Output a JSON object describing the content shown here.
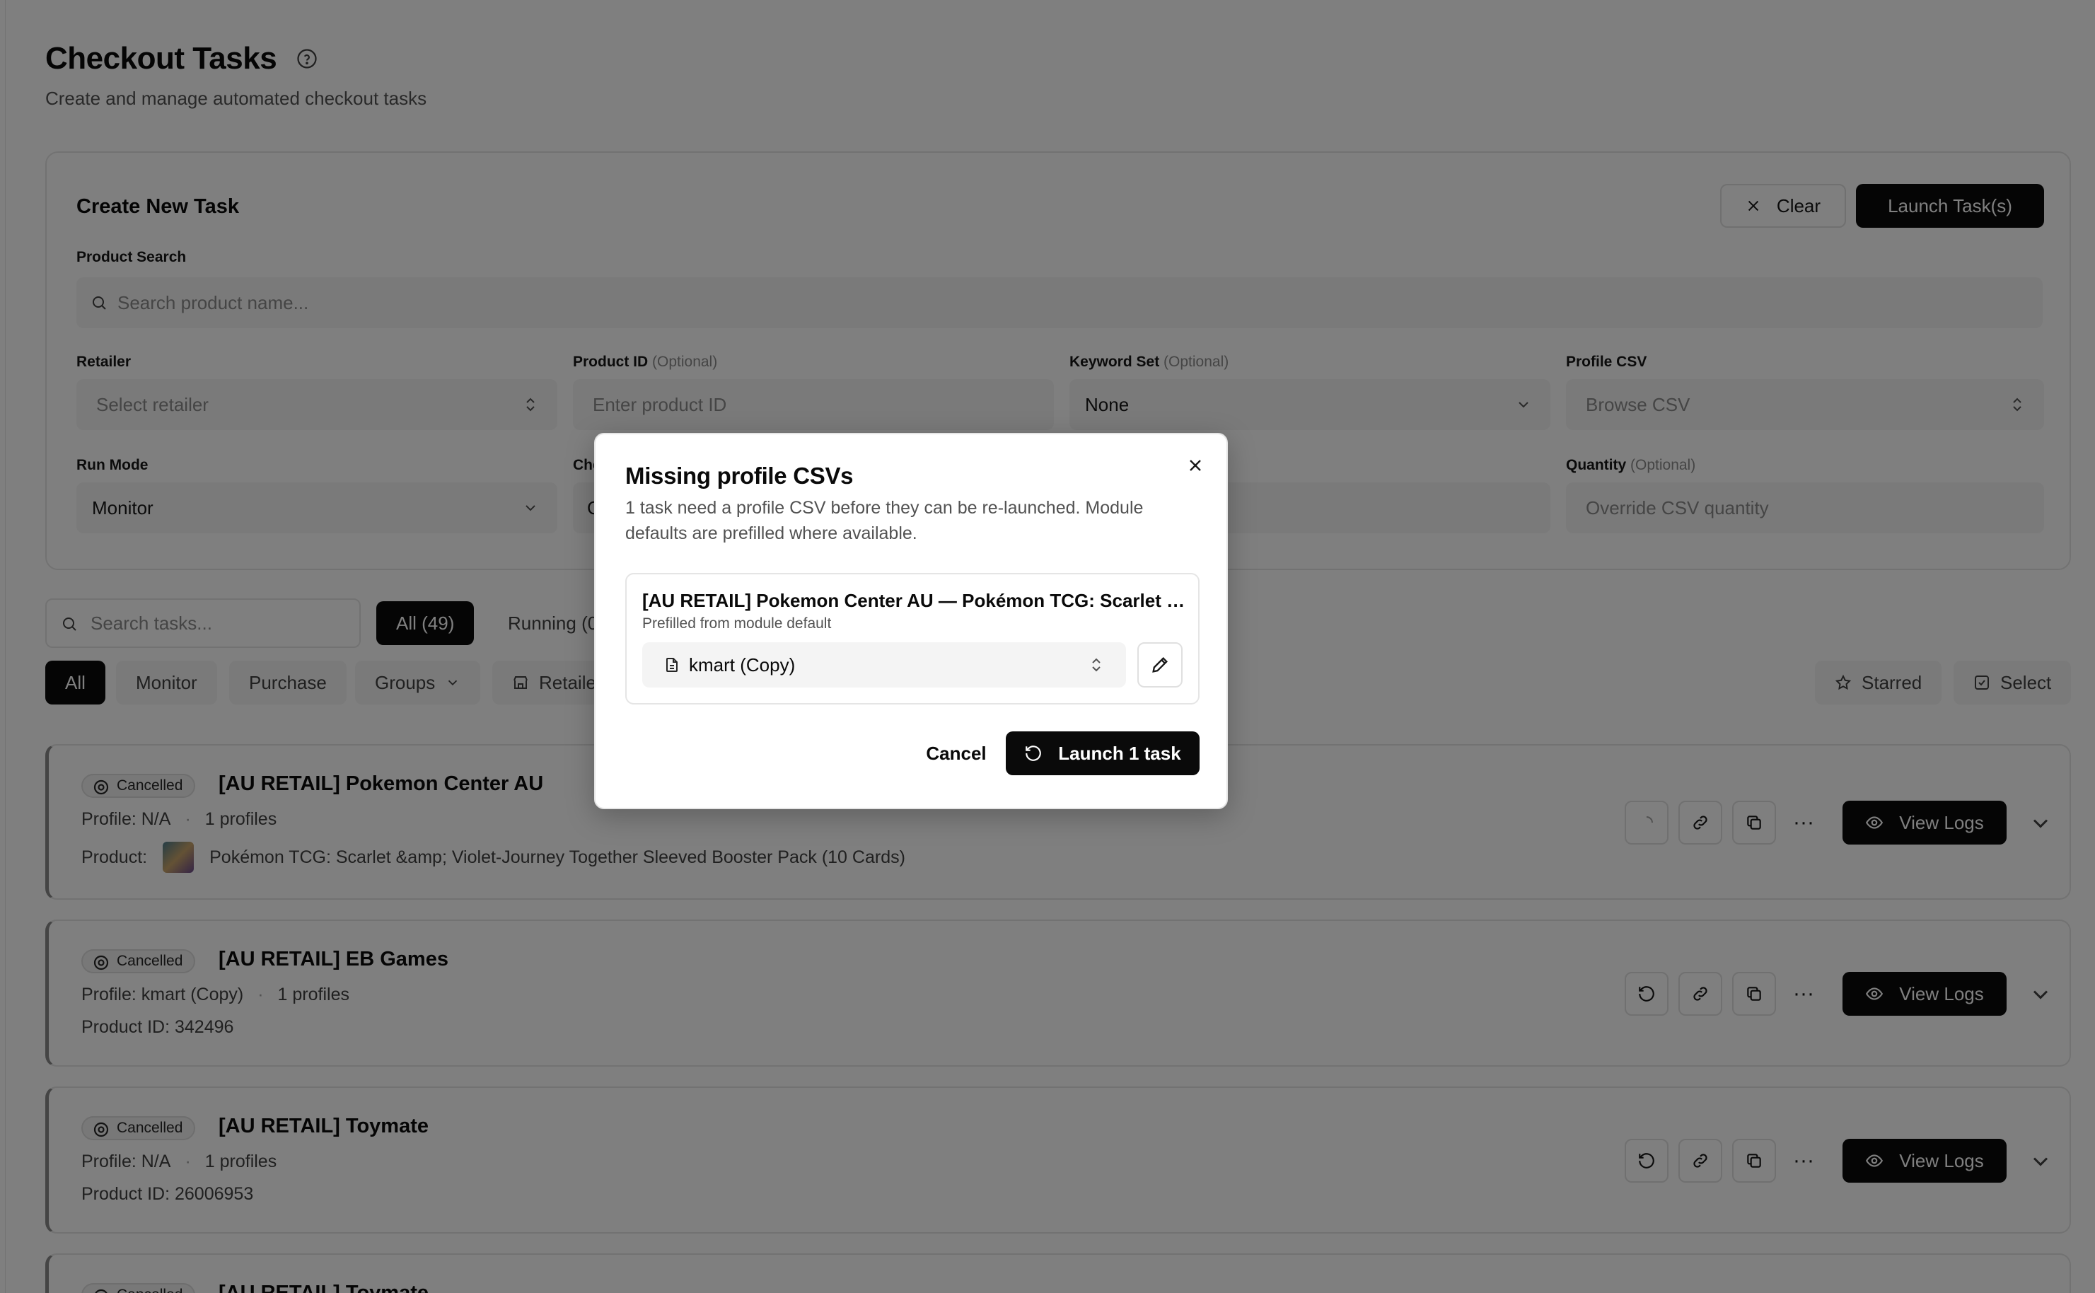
{
  "header": {
    "title": "Checkout Tasks",
    "subtitle": "Create and manage automated checkout tasks"
  },
  "create_task": {
    "title": "Create New Task",
    "clear_label": "Clear",
    "launch_label": "Launch Task(s)",
    "product_search": {
      "label": "Product Search",
      "placeholder": "Search product name..."
    },
    "retailer": {
      "label": "Retailer",
      "placeholder": "Select retailer"
    },
    "product_id": {
      "label": "Product ID",
      "optional": "(Optional)",
      "placeholder": "Enter product ID"
    },
    "keyword_set": {
      "label": "Keyword Set",
      "optional": "(Optional)",
      "value": "None"
    },
    "profile_csv": {
      "label": "Profile CSV",
      "placeholder": "Browse CSV"
    },
    "run_mode": {
      "label": "Run Mode",
      "value": "Monitor"
    },
    "checkout_partial": {
      "label": "Che",
      "value": "C"
    },
    "quantity": {
      "label": "Quantity",
      "optional": "(Optional)",
      "placeholder": "Override CSV quantity"
    }
  },
  "filters": {
    "search_placeholder": "Search tasks...",
    "status_tabs": [
      {
        "label": "All (49)"
      },
      {
        "label": "Running (0"
      }
    ],
    "mode_tabs": [
      {
        "label": "All"
      },
      {
        "label": "Monitor"
      },
      {
        "label": "Purchase"
      },
      {
        "label": "Groups"
      },
      {
        "label": "Retaile"
      }
    ],
    "starred_label": "Starred",
    "select_label": "Select"
  },
  "tasks": [
    {
      "status": "Cancelled",
      "name": "[AU RETAIL] Pokemon Center AU",
      "profile": "Profile: N/A",
      "profiles_count": "1 profiles",
      "product_label": "Product:",
      "product": "Pokémon TCG: Scarlet &amp; Violet-Journey Together Sleeved Booster Pack (10 Cards)",
      "view_logs": "View Logs"
    },
    {
      "status": "Cancelled",
      "name": "[AU RETAIL] EB Games",
      "profile": "Profile: kmart (Copy)",
      "profiles_count": "1 profiles",
      "product_id": "Product ID: 342496",
      "view_logs": "View Logs"
    },
    {
      "status": "Cancelled",
      "name": "[AU RETAIL] Toymate",
      "profile": "Profile: N/A",
      "profiles_count": "1 profiles",
      "product_id": "Product ID: 26006953",
      "view_logs": "View Logs"
    },
    {
      "status": "Cancelled",
      "name": "[AU RETAIL] Toymate"
    }
  ],
  "modal": {
    "title": "Missing profile CSVs",
    "description": "1 task need a profile CSV before they can be re-launched. Module defaults are prefilled where available.",
    "entry_title": "[AU RETAIL] Pokemon Center AU — Pokémon TCG: Scarlet &a...",
    "entry_subtitle": "Prefilled from module default",
    "csv_value": "kmart (Copy)",
    "cancel_label": "Cancel",
    "launch_label": "Launch 1 task"
  },
  "colors": {
    "primary": "#0a0a0a",
    "overlay": "rgba(0,0,0,0.5)",
    "input_bg": "#f4f4f4",
    "border": "#e5e5e5"
  }
}
